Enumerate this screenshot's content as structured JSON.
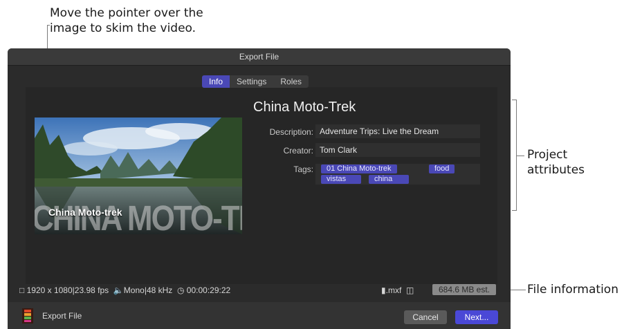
{
  "callouts": {
    "pointer_line1": "Move the pointer over the",
    "pointer_line2": "image to skim the video.",
    "project_line1": "Project",
    "project_line2": "attributes",
    "file_info": "File information"
  },
  "window": {
    "title": "Export File",
    "tabs": [
      "Info",
      "Settings",
      "Roles"
    ],
    "active_tab": "Info"
  },
  "preview": {
    "overlay_title": "China Moto-trek",
    "background_text": "CHINA MOTO-TREK"
  },
  "info": {
    "project_title": "China Moto-Trek",
    "description_label": "Description:",
    "description_value": "Adventure Trips: Live the Dream",
    "creator_label": "Creator:",
    "creator_value": "Tom Clark",
    "tags_label": "Tags:",
    "tags": [
      "01 China Moto-trek",
      "food",
      "vistas",
      "china"
    ]
  },
  "status_bar": {
    "resolution": "1920 x 1080",
    "fps": "23.98 fps",
    "audio": "Mono",
    "sample_rate": "48 kHz",
    "duration": "00:00:29:22",
    "extension": ".mxf",
    "estimate": "684.6 MB est."
  },
  "footer": {
    "label": "Export File",
    "cancel": "Cancel",
    "next": "Next..."
  },
  "colors": {
    "accent": "#4a48b6",
    "window_bg": "#2b2b2b"
  }
}
